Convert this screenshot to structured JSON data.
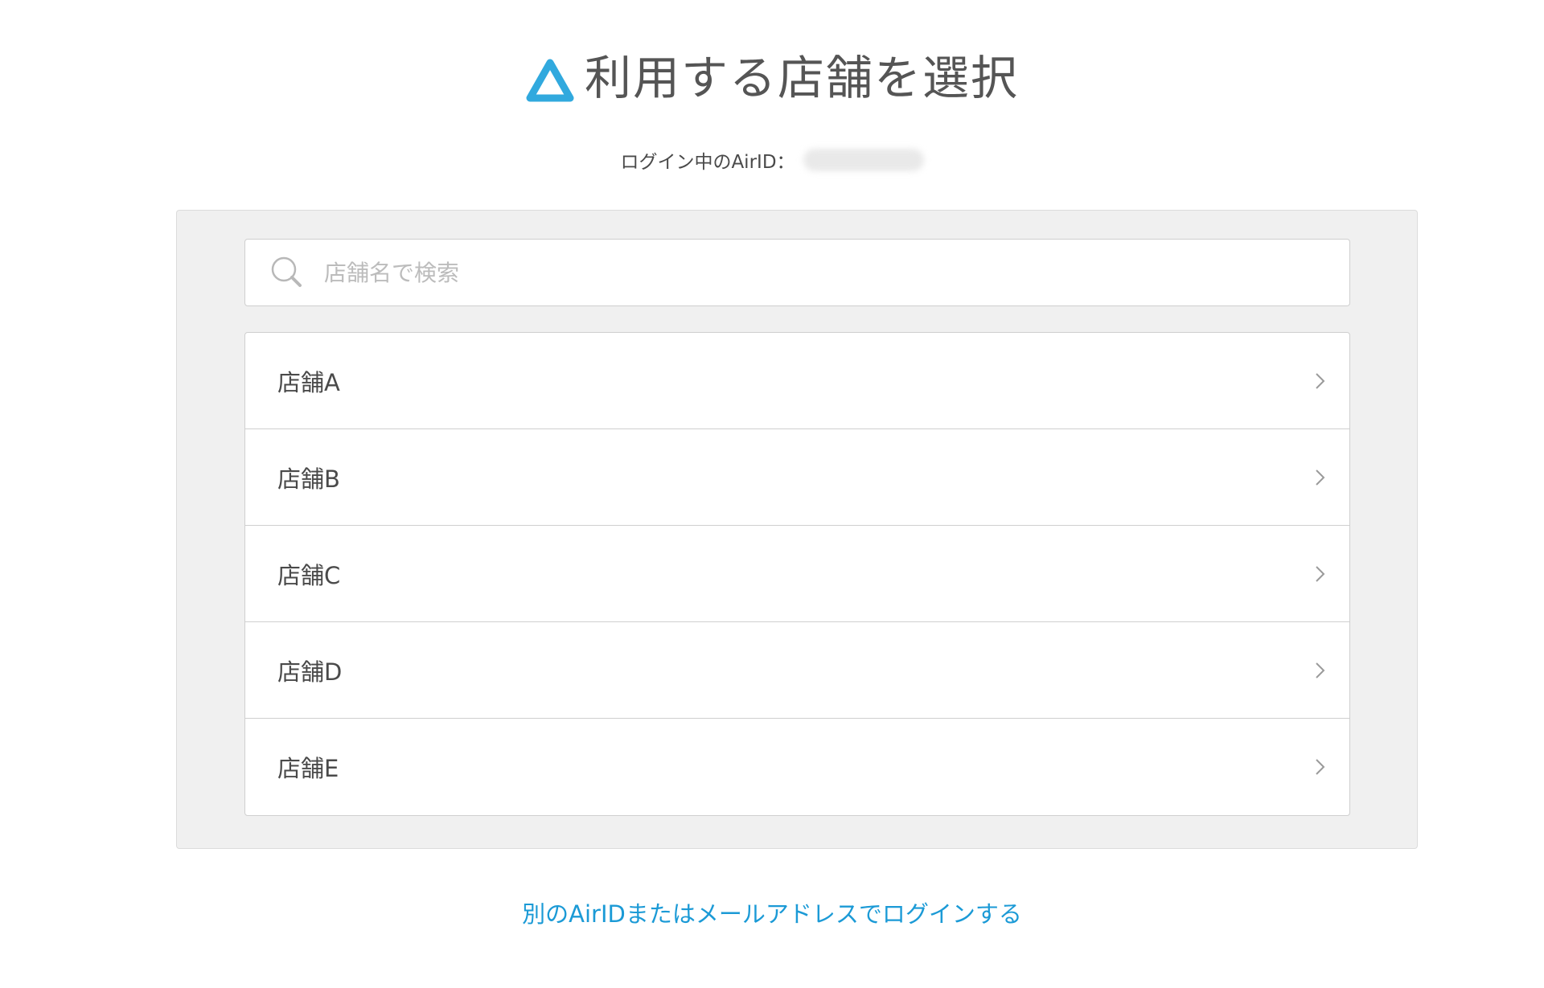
{
  "header": {
    "title": "利用する店舗を選択",
    "logo_icon": "air-logo-icon",
    "logo_color": "#31a9de"
  },
  "login_info": {
    "label": "ログイン中のAirID："
  },
  "search": {
    "placeholder": "店舗名で検索",
    "value": "",
    "icon": "search-icon"
  },
  "stores": {
    "items": [
      {
        "label": "店舗A"
      },
      {
        "label": "店舗B"
      },
      {
        "label": "店舗C"
      },
      {
        "label": "店舗D"
      },
      {
        "label": "店舗E"
      }
    ],
    "item_icon": "chevron-right-icon"
  },
  "footer": {
    "alt_login_link": "別のAirIDまたはメールアドレスでログインする",
    "link_color": "#1b9ad6"
  }
}
